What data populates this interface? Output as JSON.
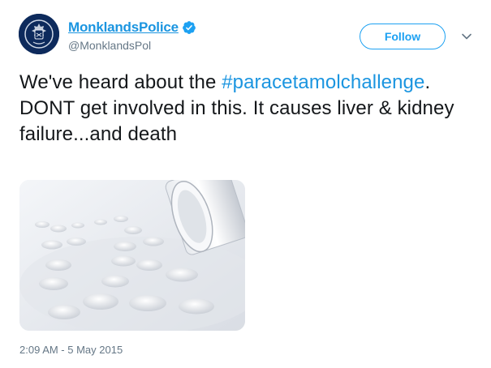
{
  "account": {
    "display_name": "MonklandsPolice",
    "handle": "@MonklandsPol",
    "verified": true,
    "avatar_icon": "police-crest-icon"
  },
  "actions": {
    "follow_label": "Follow",
    "menu_icon": "chevron-down-icon"
  },
  "tweet": {
    "text_before": "We've heard about the ",
    "hashtag": "#paracetamolchallenge",
    "text_after": ". DONT get involved in this. It causes liver & kidney failure...and death"
  },
  "media": {
    "icon": "pills-photo"
  },
  "timestamp": "2:09 AM - 5 May 2015",
  "colors": {
    "link": "#1b95e0",
    "follow": "#1da1f2",
    "muted": "#657786",
    "text": "#14171a"
  }
}
